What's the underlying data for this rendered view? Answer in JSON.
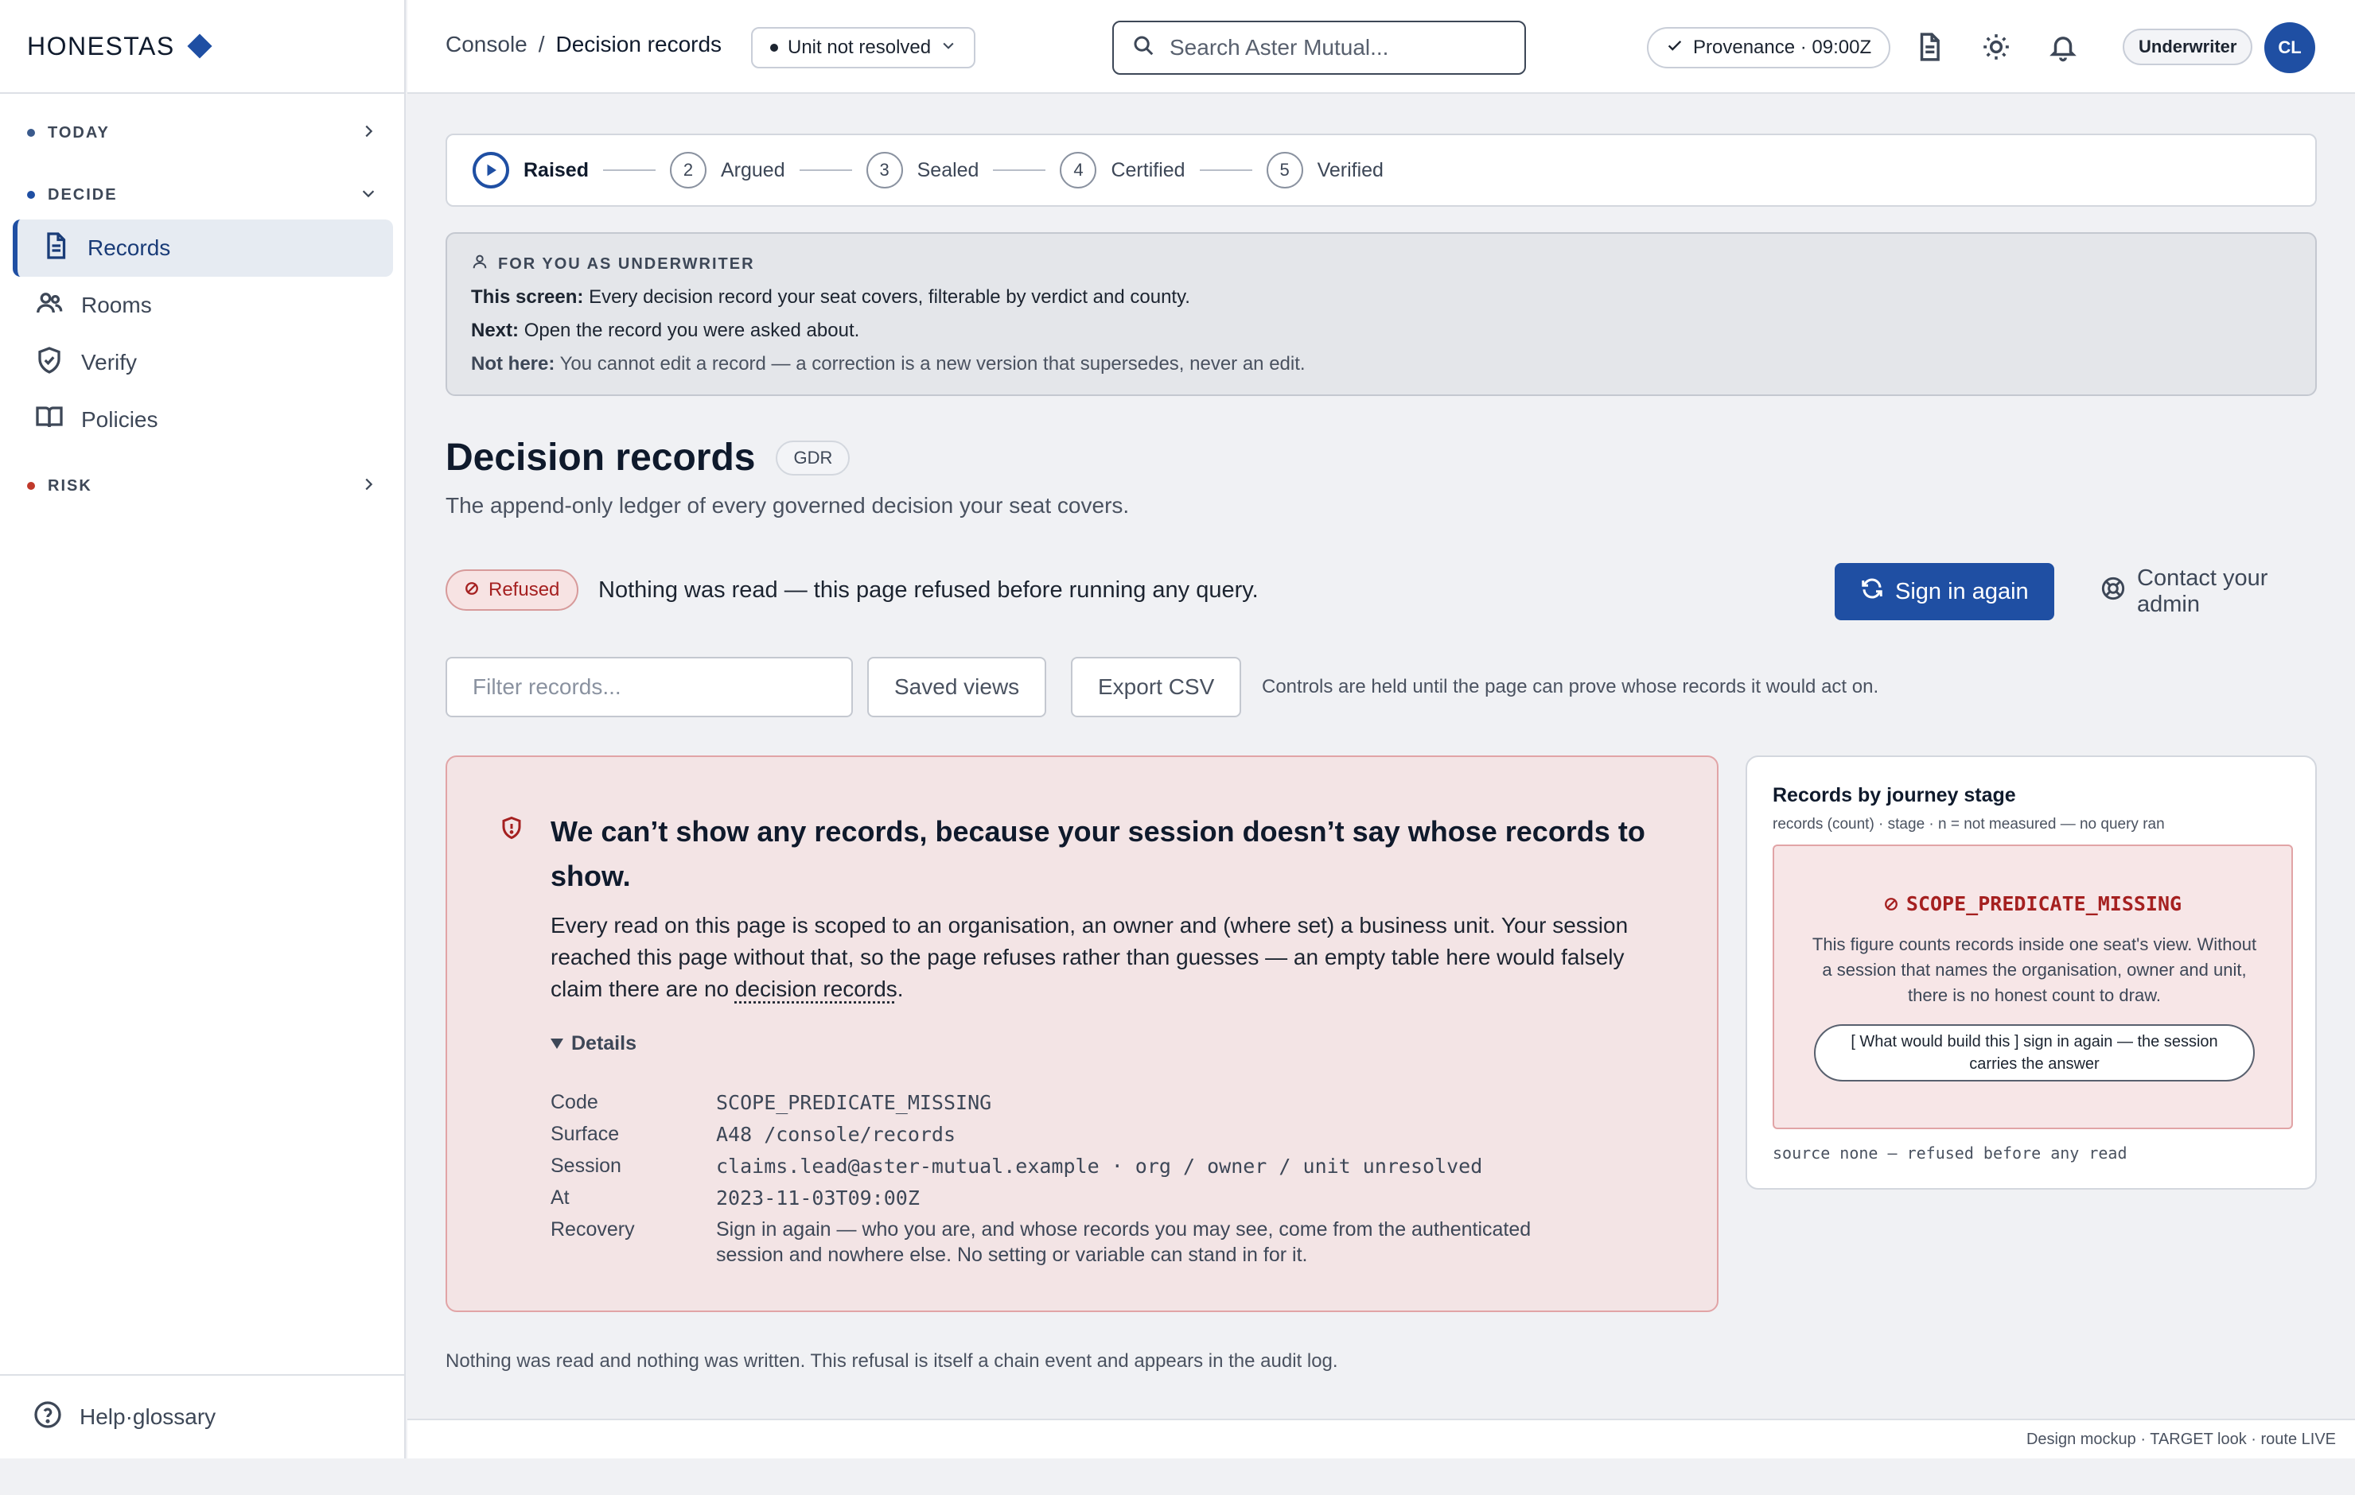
{
  "brand": {
    "name": "HONESTAS"
  },
  "sidebar": {
    "sections": [
      {
        "label": "TODAY",
        "dot_color": "#3a5a8c"
      },
      {
        "label": "DECIDE",
        "dot_color": "#1f4fa3"
      },
      {
        "label": "RISK",
        "dot_color": "#c0392b"
      }
    ],
    "items": [
      {
        "label": "Records",
        "icon": "document-icon",
        "active": true
      },
      {
        "label": "Rooms",
        "icon": "users-icon"
      },
      {
        "label": "Verify",
        "icon": "shield-check-icon"
      },
      {
        "label": "Policies",
        "icon": "book-icon"
      }
    ],
    "footer": {
      "label": "Help·glossary",
      "icon": "help-circle-icon"
    }
  },
  "topbar": {
    "breadcrumb": {
      "root": "Console",
      "separator": "/",
      "current": "Decision records"
    },
    "unit_selector": "Unit not resolved",
    "search_placeholder": "Search Aster Mutual...",
    "provenance": "Provenance · 09:00Z",
    "role": "Underwriter",
    "avatar_initials": "CL"
  },
  "stepper": {
    "steps": [
      {
        "num": "",
        "label": "Raised",
        "active": true
      },
      {
        "num": "2",
        "label": "Argued"
      },
      {
        "num": "3",
        "label": "Sealed"
      },
      {
        "num": "4",
        "label": "Certified"
      },
      {
        "num": "5",
        "label": "Verified"
      }
    ]
  },
  "guide": {
    "heading": "FOR YOU AS UNDERWRITER",
    "this_screen_label": "This screen:",
    "this_screen": "Every decision record your seat covers, filterable by verdict and county.",
    "next_label": "Next:",
    "next": "Open the record you were asked about.",
    "not_here_label": "Not here:",
    "not_here": "You cannot edit a record — a correction is a new version that supersedes, never an edit."
  },
  "page": {
    "title": "Decision records",
    "badge": "GDR",
    "subtitle": "The append-only ledger of every governed decision your seat covers."
  },
  "refusal": {
    "pill": "Refused",
    "message": "Nothing was read — this page refused before running any query.",
    "primary_action": "Sign in again",
    "secondary_action": "Contact your admin"
  },
  "controls": {
    "filter_placeholder": "Filter records...",
    "saved_views": "Saved views",
    "export": "Export CSV",
    "note": "Controls are held until the page can prove whose records it would act on."
  },
  "error": {
    "title": "We can’t show any records, because your session doesn’t say whose records to show.",
    "body_pre": "Every read on this page is scoped to an organisation, an owner and (where set) a business unit. Your session reached this page without that, so the page refuses rather than guesses — an empty table here would falsely claim there are no ",
    "body_link": "decision records",
    "body_post": ".",
    "details_label": "Details",
    "details": [
      {
        "key": "Code",
        "value": "SCOPE_PREDICATE_MISSING"
      },
      {
        "key": "Surface",
        "value": "A48 /console/records"
      },
      {
        "key": "Session",
        "value": "claims.lead@aster-mutual.example · org / owner / unit unresolved"
      },
      {
        "key": "At",
        "value": "2023-11-03T09:00Z"
      },
      {
        "key": "Recovery",
        "value": "Sign in again — who you are, and whose records you may see, come from the authenticated session and nowhere else. No setting or variable can stand in for it."
      }
    ]
  },
  "stage_card": {
    "title": "Records by journey stage",
    "subtitle": "records (count) · stage · n = not measured — no query ran",
    "code": "SCOPE_PREDICATE_MISSING",
    "text": "This figure counts records inside one seat's view. Without a session that names the organisation, owner and unit, there is no honest count to draw.",
    "button": "[ What would build this ] sign in again — the session carries the answer",
    "source": "source none — refused before any read"
  },
  "footnote": "Nothing was read and nothing was written. This refusal is itself a chain event and appears in the audit log.",
  "statusbar": "Design mockup · TARGET look · route LIVE",
  "colors": {
    "accent": "#1f4fa3",
    "danger": "#a52020",
    "danger_bg": "#f3e4e5"
  }
}
